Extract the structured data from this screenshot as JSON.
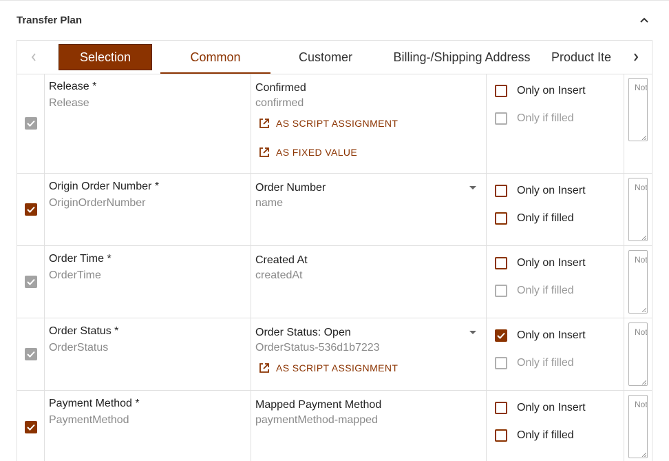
{
  "panel": {
    "title": "Transfer Plan"
  },
  "tabs": {
    "items": [
      {
        "label": "Selection"
      },
      {
        "label": "Common"
      },
      {
        "label": "Customer"
      },
      {
        "label": "Billing-/Shipping Address"
      },
      {
        "label": "Product Ite"
      }
    ]
  },
  "actions": {
    "script_assignment": "AS SCRIPT ASSIGNMENT",
    "fixed_value": "AS FIXED VALUE"
  },
  "options": {
    "only_on_insert": "Only on Insert",
    "only_if_filled": "Only if filled"
  },
  "note_placeholder": "Not",
  "rows": [
    {
      "field_name": "Release *",
      "field_key": "Release",
      "map_value": "Confirmed",
      "map_key": "confirmed",
      "selected": true,
      "selected_disabled": true,
      "only_on_insert": false,
      "only_if_filled": false,
      "only_if_filled_disabled": true
    },
    {
      "field_name": "Origin Order Number *",
      "field_key": "OriginOrderNumber",
      "map_value": "Order Number",
      "map_key": "name",
      "selected": true,
      "selected_disabled": false,
      "only_on_insert": false,
      "only_if_filled": false,
      "only_if_filled_disabled": false
    },
    {
      "field_name": "Order Time *",
      "field_key": "OrderTime",
      "map_value": "Created At",
      "map_key": "createdAt",
      "selected": true,
      "selected_disabled": true,
      "only_on_insert": false,
      "only_if_filled": false,
      "only_if_filled_disabled": true
    },
    {
      "field_name": "Order Status *",
      "field_key": "OrderStatus",
      "map_value": "Order Status: Open",
      "map_key": "OrderStatus-536d1b7223",
      "selected": true,
      "selected_disabled": true,
      "only_on_insert": true,
      "only_if_filled": false,
      "only_if_filled_disabled": true
    },
    {
      "field_name": "Payment Method *",
      "field_key": "PaymentMethod",
      "map_value": "Mapped Payment Method",
      "map_key": "paymentMethod-mapped",
      "selected": true,
      "selected_disabled": false,
      "only_on_insert": false,
      "only_if_filled": false,
      "only_if_filled_disabled": false
    }
  ],
  "colors": {
    "accent": "#8b3300",
    "disabled": "#a3a3a3",
    "border": "#e0e0e0"
  }
}
